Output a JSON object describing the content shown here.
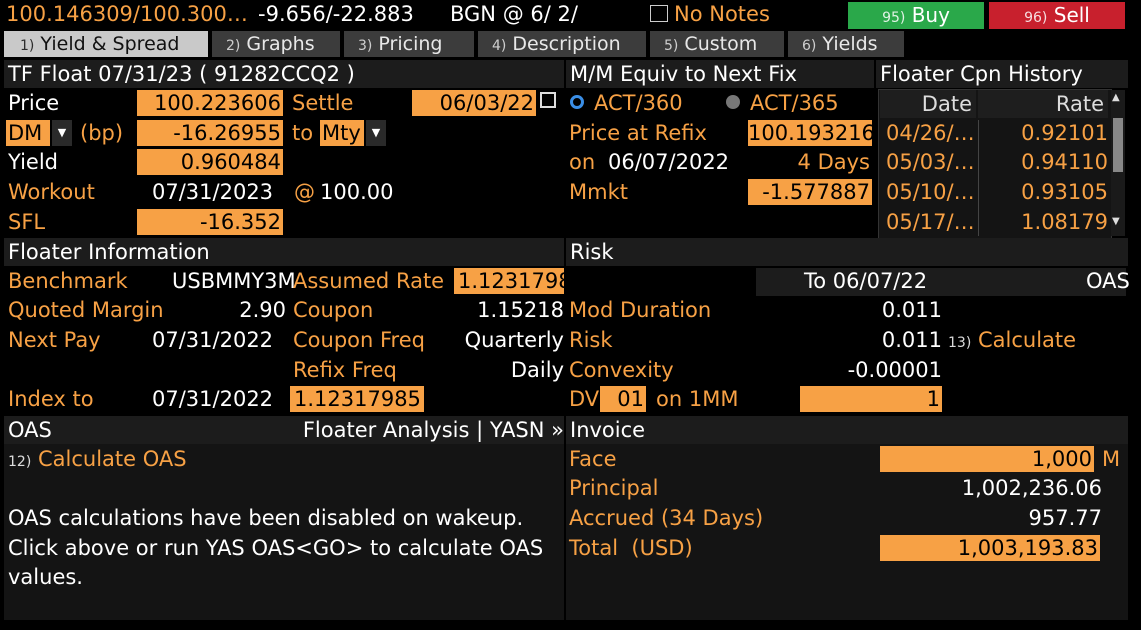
{
  "topbar": {
    "price_quote": "100.146309/100.300…",
    "yield_quote": "-9.656/-22.883",
    "source": "BGN @ 6/ 2/",
    "notes": "No Notes",
    "buy_num": "95)",
    "buy_label": "Buy",
    "sell_num": "96)",
    "sell_label": "Sell",
    "buy_color": "#2aa84a",
    "sell_color": "#c8202d"
  },
  "tabs": [
    {
      "num": "1)",
      "label": "Yield & Spread"
    },
    {
      "num": "2)",
      "label": "Graphs"
    },
    {
      "num": "3)",
      "label": "Pricing"
    },
    {
      "num": "4)",
      "label": "Description"
    },
    {
      "num": "5)",
      "label": "Custom"
    },
    {
      "num": "6)",
      "label": "Yields"
    }
  ],
  "bond": {
    "title": "TF Float 07/31/23 ( 91282CCQ2 )",
    "price_label": "Price",
    "price": "100.223606",
    "settle_label": "Settle",
    "settle_date": "06/03/22",
    "dm_select": "DM",
    "bp_label": "(bp)",
    "dm_value": "-16.26955",
    "to_label": "to",
    "to_select": "Mty",
    "yield_label": "Yield",
    "yield": "0.960484",
    "workout_label": "Workout",
    "workout_date": "07/31/2023",
    "at_sign": "@",
    "workout_price": "100.00",
    "sfl_label": "SFL",
    "sfl": "-16.352"
  },
  "mm": {
    "title": "M/M Equiv to Next Fix",
    "act360": "ACT/360",
    "act365": "ACT/365",
    "price_refix_label": "Price at Refix",
    "price_refix": "100.193216",
    "on_label": "on",
    "on_date": "06/07/2022",
    "days": "4 Days",
    "mmkt_label": "Mmkt",
    "mmkt": "-1.577887"
  },
  "history": {
    "title": "Floater Cpn History",
    "col_date": "Date",
    "col_rate": "Rate",
    "rows": [
      {
        "date": "04/26/…",
        "rate": "0.92101"
      },
      {
        "date": "05/03/…",
        "rate": "0.94110"
      },
      {
        "date": "05/10/…",
        "rate": "0.93105"
      },
      {
        "date": "05/17/…",
        "rate": "1.08179"
      }
    ]
  },
  "floater": {
    "title": "Floater Information",
    "benchmark_label": "Benchmark",
    "benchmark": "USBMMY3M",
    "assumed_rate_label": "Assumed Rate",
    "assumed_rate": "1.12317985",
    "quoted_margin_label": "Quoted Margin",
    "quoted_margin": "2.90",
    "coupon_label": "Coupon",
    "coupon": "1.15218",
    "next_pay_label": "Next Pay",
    "next_pay": "07/31/2022",
    "coupon_freq_label": "Coupon Freq",
    "coupon_freq": "Quarterly",
    "refix_freq_label": "Refix Freq",
    "refix_freq": "Daily",
    "index_to_label": "Index to",
    "index_to_date": "07/31/2022",
    "index_to_value": "1.12317985"
  },
  "risk": {
    "title": "Risk",
    "to_header": "To 06/07/22",
    "oas_header": "OAS",
    "mod_duration_label": "Mod Duration",
    "mod_duration": "0.011",
    "risk_label": "Risk",
    "risk": "0.011",
    "calc_num": "13)",
    "calc_label": "Calculate",
    "convexity_label": "Convexity",
    "convexity": "-0.00001",
    "dv_label": "DV",
    "dv_select": "01",
    "on_1mm_label": "on 1MM",
    "dv_value": "1"
  },
  "oas": {
    "title": "OAS",
    "link": "Floater Analysis | YASN »",
    "calc_num": "12)",
    "calc_label": "Calculate OAS",
    "message_line1": "OAS calculations have been disabled on wakeup.",
    "message_line2": "Click above or run YAS OAS<GO> to calculate OAS",
    "message_line3": "values."
  },
  "invoice": {
    "title": "Invoice",
    "face_label": "Face",
    "face": "1,000",
    "face_unit": "M",
    "principal_label": "Principal",
    "principal": "1,002,236.06",
    "accrued_label": "Accrued (34 Days)",
    "accrued": "957.77",
    "total_label": "Total  (USD)",
    "total": "1,003,193.83"
  }
}
